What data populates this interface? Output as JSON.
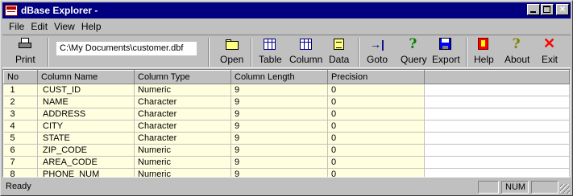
{
  "window": {
    "title": "dBase Explorer -"
  },
  "menu": [
    "File",
    "Edit",
    "View",
    "Help"
  ],
  "toolbar": {
    "print": "Print",
    "path": "C:\\My Documents\\customer.dbf",
    "open": "Open",
    "table": "Table",
    "column": "Column",
    "data": "Data",
    "goto": "Goto",
    "query": "Query",
    "export": "Export",
    "help": "Help",
    "about": "About",
    "exit": "Exit"
  },
  "grid": {
    "headers": [
      "No",
      "Column Name",
      "Column Type",
      "Column Length",
      "Precision"
    ],
    "rows": [
      [
        "1",
        "CUST_ID",
        "Numeric",
        "9",
        "0"
      ],
      [
        "2",
        "NAME",
        "Character",
        "9",
        "0"
      ],
      [
        "3",
        "ADDRESS",
        "Character",
        "9",
        "0"
      ],
      [
        "4",
        "CITY",
        "Character",
        "9",
        "0"
      ],
      [
        "5",
        "STATE",
        "Character",
        "9",
        "0"
      ],
      [
        "6",
        "ZIP_CODE",
        "Numeric",
        "9",
        "0"
      ],
      [
        "7",
        "AREA_CODE",
        "Numeric",
        "9",
        "0"
      ],
      [
        "8",
        "PHONE_NUM",
        "Numeric",
        "9",
        "0"
      ]
    ]
  },
  "status": {
    "text": "Ready",
    "num": "NUM"
  },
  "colors": {
    "title_bar": "#000080",
    "cell_bg": "#ffffe0",
    "chrome": "#c0c0c0"
  }
}
